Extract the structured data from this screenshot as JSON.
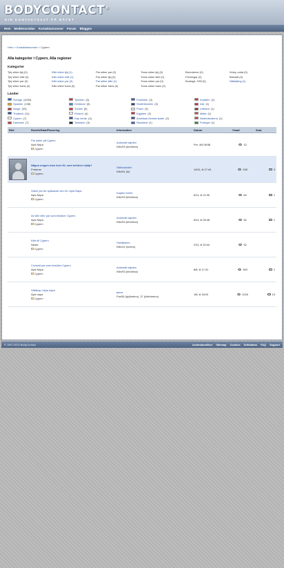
{
  "header": {
    "logo": "BODYCONTACT",
    "logo_mark": "®",
    "tagline": "DIN KONTAKTSAJT PÅ NÄTET"
  },
  "nav": [
    "Hem",
    "Medlemssidan",
    "Kontaktannonser",
    "Forum",
    "Bloggen"
  ],
  "breadcrumb": {
    "home": "Hem",
    "ads": "Kontaktannonser",
    "current": "Cypern",
    "sep": ">"
  },
  "page_title": "Alla kategorier i Cypern, Alla regioner",
  "categories_heading": "Kategorier",
  "categories": [
    {
      "label": "Tjej söker tjej (0)",
      "link": false
    },
    {
      "label": "Kille söker tjej (1)",
      "link": true
    },
    {
      "label": "Par söker par (0)",
      "link": false
    },
    {
      "label": "Trans söker tjej (0)",
      "link": false
    },
    {
      "label": "Brevvänner (0)",
      "link": false
    },
    {
      "label": "Kinky, udda (0)",
      "link": false
    },
    {
      "label": "Tjej söker kille (0)",
      "link": false
    },
    {
      "label": "Kille söker kille (1)",
      "link": true
    },
    {
      "label": "Par söker tjej (0)",
      "link": false
    },
    {
      "label": "Trans söker kille (0)",
      "link": false
    },
    {
      "label": "Förmingar (0)",
      "link": false
    },
    {
      "label": "Blandat (0)",
      "link": false
    },
    {
      "label": "Tjej söker par (0)",
      "link": false
    },
    {
      "label": "Kille söker par (3)",
      "link": true
    },
    {
      "label": "Par söker kille (1)",
      "link": true
    },
    {
      "label": "Trans söker par (0)",
      "link": false
    },
    {
      "label": "Bordage, S/M (0)",
      "link": false
    },
    {
      "label": "Nätdejting (1)",
      "link": true
    },
    {
      "label": "Tjej söker trans (0)",
      "link": false
    },
    {
      "label": "Kille söker trans (0)",
      "link": false
    },
    {
      "label": "Par söker trans (0)",
      "link": false
    },
    {
      "label": "Trans söker trans (0)",
      "link": false
    },
    {
      "label": "",
      "link": false
    },
    {
      "label": "",
      "link": false
    }
  ],
  "countries_heading": "Länder",
  "countries": [
    {
      "name": "Sverige",
      "count": "(4433)",
      "flag": "#2f6fb5"
    },
    {
      "name": "Tjeckien",
      "count": "(3)",
      "flag": "#c33a3a"
    },
    {
      "name": "Frankrike",
      "count": "(3)",
      "flag": "#3b5bb0"
    },
    {
      "name": "Kroatien",
      "count": "(1)",
      "flag": "#c63b3b"
    },
    {
      "name": "Spanien",
      "count": "(138)",
      "flag": "#d8a820"
    },
    {
      "name": "Grekland",
      "count": "(5)",
      "flag": "#4c84c9"
    },
    {
      "name": "Storbritannien",
      "count": "(3)",
      "flag": "#2b3f8d"
    },
    {
      "name": "Irak",
      "count": "(1)",
      "flag": "#b33"
    },
    {
      "name": "Norge",
      "count": "(33)",
      "flag": "#c2363f"
    },
    {
      "name": "Turkiet",
      "count": "(5)",
      "flag": "#d33"
    },
    {
      "name": "Polen",
      "count": "(3)",
      "flag": "#e6e6e6"
    },
    {
      "name": "Lettland",
      "count": "(1)",
      "flag": "#8d2b33"
    },
    {
      "name": "Thailand",
      "count": "(11)",
      "flag": "#2c4da0"
    },
    {
      "name": "Finland",
      "count": "(4)",
      "flag": "#f3f6fb"
    },
    {
      "name": "Egypten",
      "count": "(2)",
      "flag": "#c33"
    },
    {
      "name": "Malta",
      "count": "(1)",
      "flag": "#d84747"
    },
    {
      "name": "Cypern",
      "count": "(7)",
      "flag": "#f4f4f4"
    },
    {
      "name": "Kap Verde",
      "count": "(3)",
      "flag": "#2d56a8"
    },
    {
      "name": "Amerikas förenta stater",
      "count": "(2)",
      "flag": "#3a4b8f"
    },
    {
      "name": "Nederländerna",
      "count": "(1)",
      "flag": "#c44"
    },
    {
      "name": "Danmark",
      "count": "(7)",
      "flag": "#c8343b"
    },
    {
      "name": "Tyskland",
      "count": "(3)",
      "flag": "#1a1a1a"
    },
    {
      "name": "Ryssland",
      "count": "(1)",
      "flag": "#3c62b6"
    },
    {
      "name": "Portugal",
      "count": "(1)",
      "flag": "#2a8a3d"
    }
  ],
  "table": {
    "headers": [
      "Bild",
      "Rubrik/Stad/Placering",
      "Information",
      "Datum",
      "Visad",
      "Svar"
    ],
    "rows": [
      {
        "title": "Par söker på Cypern",
        "bold": false,
        "city": "Ayia Napa",
        "area": "Cypern",
        "info_name": "Automatt skjuten",
        "info_sub": "Kille/53 (bi/villesn)",
        "date": "Fre, 4/6 08:58",
        "views": "13",
        "replies": "",
        "avatar": false,
        "highlight": false
      },
      {
        "title": "Någon mogen man över 60, som behöver hjälp?",
        "bold": true,
        "city": "Protaras",
        "area": "Cypern",
        "info_name": "Skitbolanden",
        "info_sub": "Kille/61 (bi)",
        "date": "14/11, kl 17:44",
        "views": "138",
        "replies": "3",
        "avatar": true,
        "highlight": true
      },
      {
        "title": "Söker par för späkande sex bil / Ayia Napa",
        "bold": false,
        "city": "Ayia Napa",
        "area": "Cypern",
        "info_name": "Kapten Kenth",
        "info_sub": "Kille/53 (bi/villesn)",
        "date": "6/11, kl 21:39",
        "views": "64",
        "replies": "1",
        "avatar": false,
        "highlight": false
      },
      {
        "title": "Av kille eller par som besöker Cypern",
        "bold": false,
        "city": "Ayia Napa",
        "area": "Cypern",
        "info_name": "Automatt skjuten",
        "info_sub": "Kille/53 (bi/villesn)",
        "date": "6/11, kl 09:46",
        "views": "54",
        "replies": "1",
        "avatar": false,
        "highlight": false
      },
      {
        "title": "Kille till Cypern",
        "bold": false,
        "city": "Isbala",
        "area": "Cypern",
        "info_name": "Husläkaren",
        "info_sub": "Kille/42 (hetero)",
        "date": "2/11, kl 20:44",
        "views": "92",
        "replies": "",
        "avatar": false,
        "highlight": false
      },
      {
        "title": "Cuckold par som besöker Cypern",
        "bold": false,
        "city": "Ayia Napa",
        "area": "Cypern",
        "info_name": "Automatt skjuten",
        "info_sub": "Kille/53 (bi/villesn)",
        "date": "8/8, kl 17:41",
        "views": "169",
        "replies": "1",
        "avatar": false,
        "highlight": false
      },
      {
        "title": "Sällskap i Ayia napa",
        "bold": false,
        "city": "Ayia napa",
        "area": "Cypern",
        "info_name": "janus",
        "info_sub": "Par/55 (tjej/hetero), 37 (kille/hetero)",
        "date": "1/8, kl 18:20",
        "views": "1218",
        "replies": "13",
        "avatar": false,
        "highlight": false
      }
    ]
  },
  "footer": {
    "copy": "© 1997-2023 BodyContact",
    "links": [
      "Användarvillkor",
      "Sitemap",
      "Cookies",
      "Driftstatus",
      "FAQ",
      "Support"
    ]
  }
}
